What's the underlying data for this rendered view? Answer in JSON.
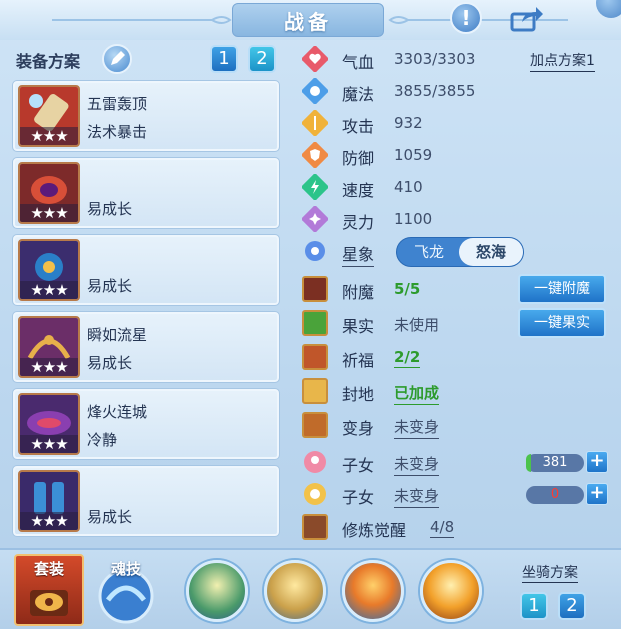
{
  "header": {
    "title": "战备"
  },
  "left": {
    "scheme_label": "装备方案",
    "scheme_buttons": [
      "1",
      "2"
    ],
    "plans": [
      {
        "line1": "五雷轰顶",
        "line2": "法术暴击",
        "stars": "★★★"
      },
      {
        "line1": "",
        "line2": "易成长",
        "stars": "★★★"
      },
      {
        "line1": "",
        "line2": "易成长",
        "stars": "★★★"
      },
      {
        "line1": "瞬如流星",
        "line2": "易成长",
        "stars": "★★★"
      },
      {
        "line1": "烽火连城",
        "line2": "冷静",
        "stars": "★★★"
      },
      {
        "line1": "",
        "line2": "易成长",
        "stars": "★★★"
      }
    ]
  },
  "stats": {
    "hp": {
      "label": "气血",
      "value": "3303/3303"
    },
    "mp": {
      "label": "魔法",
      "value": "3855/3855"
    },
    "atk": {
      "label": "攻击",
      "value": "932"
    },
    "def": {
      "label": "防御",
      "value": "1059"
    },
    "spd": {
      "label": "速度",
      "value": "410"
    },
    "spirit": {
      "label": "灵力",
      "value": "1100"
    },
    "point_plan": "加点方案1",
    "star": {
      "label": "星象",
      "options": [
        "飞龙",
        "怒海"
      ],
      "selected": "怒海"
    }
  },
  "extras": {
    "enchant": {
      "label": "附魔",
      "value": "5/5",
      "button": "一键附魔"
    },
    "fruit": {
      "label": "果实",
      "value": "未使用",
      "button": "一键果实"
    },
    "bless": {
      "label": "祈福",
      "value": "2/2"
    },
    "land": {
      "label": "封地",
      "value": "已加成"
    },
    "transform": {
      "label": "变身",
      "value": "未变身"
    },
    "child1": {
      "label": "子女",
      "value": "未变身",
      "counter": "381",
      "counter_fill": 0.08
    },
    "child2": {
      "label": "子女",
      "value": "未变身",
      "counter": "0",
      "counter_fill": 0
    },
    "cultivation": {
      "label": "修炼觉醒",
      "value": "4/8"
    }
  },
  "bottom": {
    "suit_label": "套装",
    "soul_label": "魂技",
    "mount_label": "坐骑方案",
    "mount_buttons": [
      "1",
      "2"
    ]
  },
  "colors": {
    "accent_blue": "#1f73c8",
    "green_value": "#2d9b2d",
    "red_value": "#ff3b30"
  }
}
